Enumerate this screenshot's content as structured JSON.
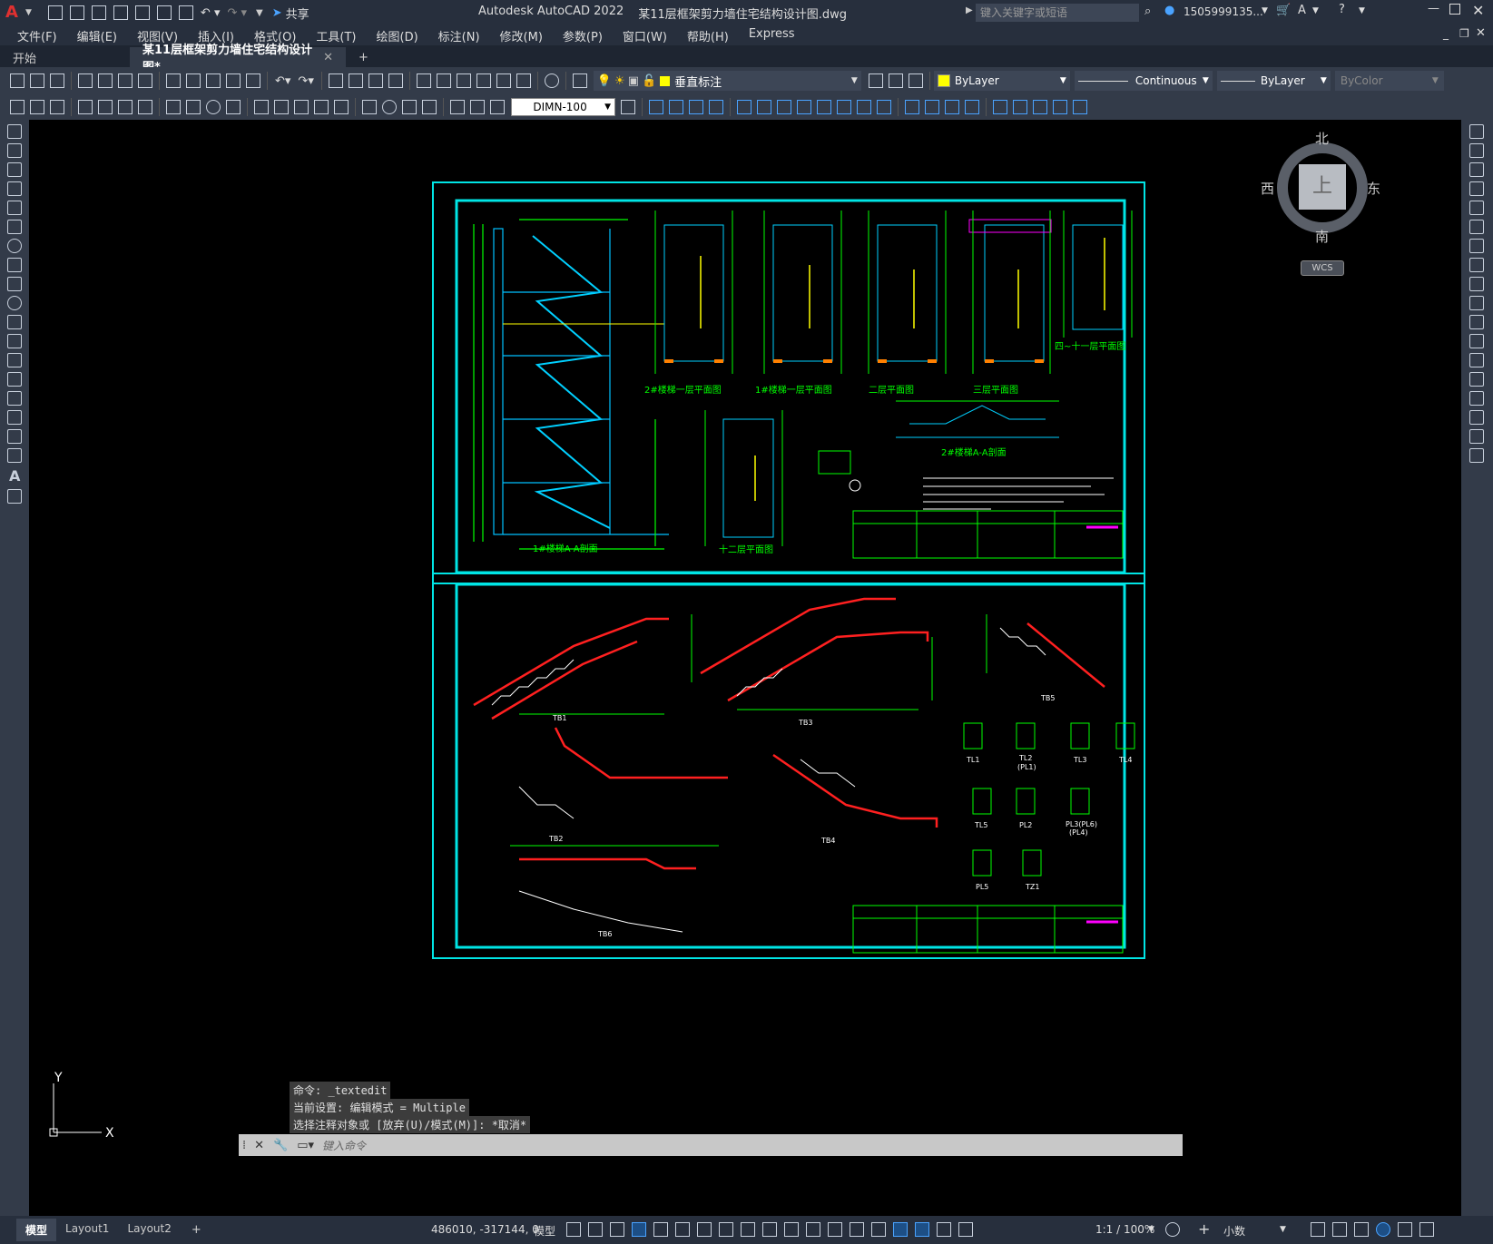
{
  "window": {
    "app_title": "Autodesk AutoCAD 2022",
    "doc_title": "某11层框架剪力墙住宅结构设计图.dwg",
    "share_label": "共享",
    "search_placeholder": "键入关键字或短语",
    "user_name": "1505999135...",
    "app_letter": "A"
  },
  "menu": {
    "items": [
      "文件(F)",
      "编辑(E)",
      "视图(V)",
      "插入(I)",
      "格式(O)",
      "工具(T)",
      "绘图(D)",
      "标注(N)",
      "修改(M)",
      "参数(P)",
      "窗口(W)",
      "帮助(H)",
      "Express"
    ]
  },
  "tabs": {
    "start": "开始",
    "doc": "某11层框架剪力墙住宅结构设计图*",
    "new": "+"
  },
  "toolbar1": {
    "layer_name": "垂直标注",
    "color": "ByLayer",
    "linetype": "Continuous",
    "lineweight": "ByLayer",
    "plotstyle": "ByColor"
  },
  "toolbar2": {
    "dimstyle": "DIMN-100"
  },
  "viewcube": {
    "north": "北",
    "south": "南",
    "east": "东",
    "west": "西",
    "face": "上",
    "wcs": "WCS"
  },
  "ucs": {
    "x_label": "X",
    "y_label": "Y"
  },
  "drawing": {
    "sheet1_labels": {
      "a1": "1#楼梯A-A剖面",
      "a2": "2#楼梯一层平面图",
      "a3": "1#楼梯一层平面图",
      "a4": "二层平面图",
      "a5": "三层平面图",
      "a6": "四~十一层平面图",
      "a7": "十二层平面图",
      "a8": "2#楼梯A-A剖面"
    },
    "sheet2_labels": {
      "tb1": "TB1",
      "tb2": "TB2",
      "tb3": "TB3",
      "tb4": "TB4",
      "tb5": "TB5",
      "tb6": "TB6",
      "tl1": "TL1",
      "tl2": "TL2",
      "tl2b": "(PL1)",
      "tl3": "TL3",
      "tl4": "TL4",
      "tl5": "TL5",
      "pl2": "PL2",
      "pl3": "PL3(PL6)",
      "pl3b": "(PL4)",
      "pl5": "PL5",
      "tz1": "TZ1"
    }
  },
  "command": {
    "history": [
      "命令: _textedit",
      "当前设置: 编辑模式 = Multiple",
      "选择注释对象或 [放弃(U)/模式(M)]: *取消*"
    ],
    "placeholder": "键入命令"
  },
  "layout_tabs": [
    "模型",
    "Layout1",
    "Layout2"
  ],
  "status": {
    "coords": "486010, -317144, 0",
    "model": "模型",
    "scale": "1:1 / 100%",
    "units": "小数"
  },
  "colors": {
    "accent": "#4aa3ff",
    "frame": "#00e5e5",
    "green": "#00ff00",
    "red": "#ff2020",
    "yellow": "#ffff00",
    "cyan": "#00d0ff",
    "magenta": "#ff00ff"
  }
}
